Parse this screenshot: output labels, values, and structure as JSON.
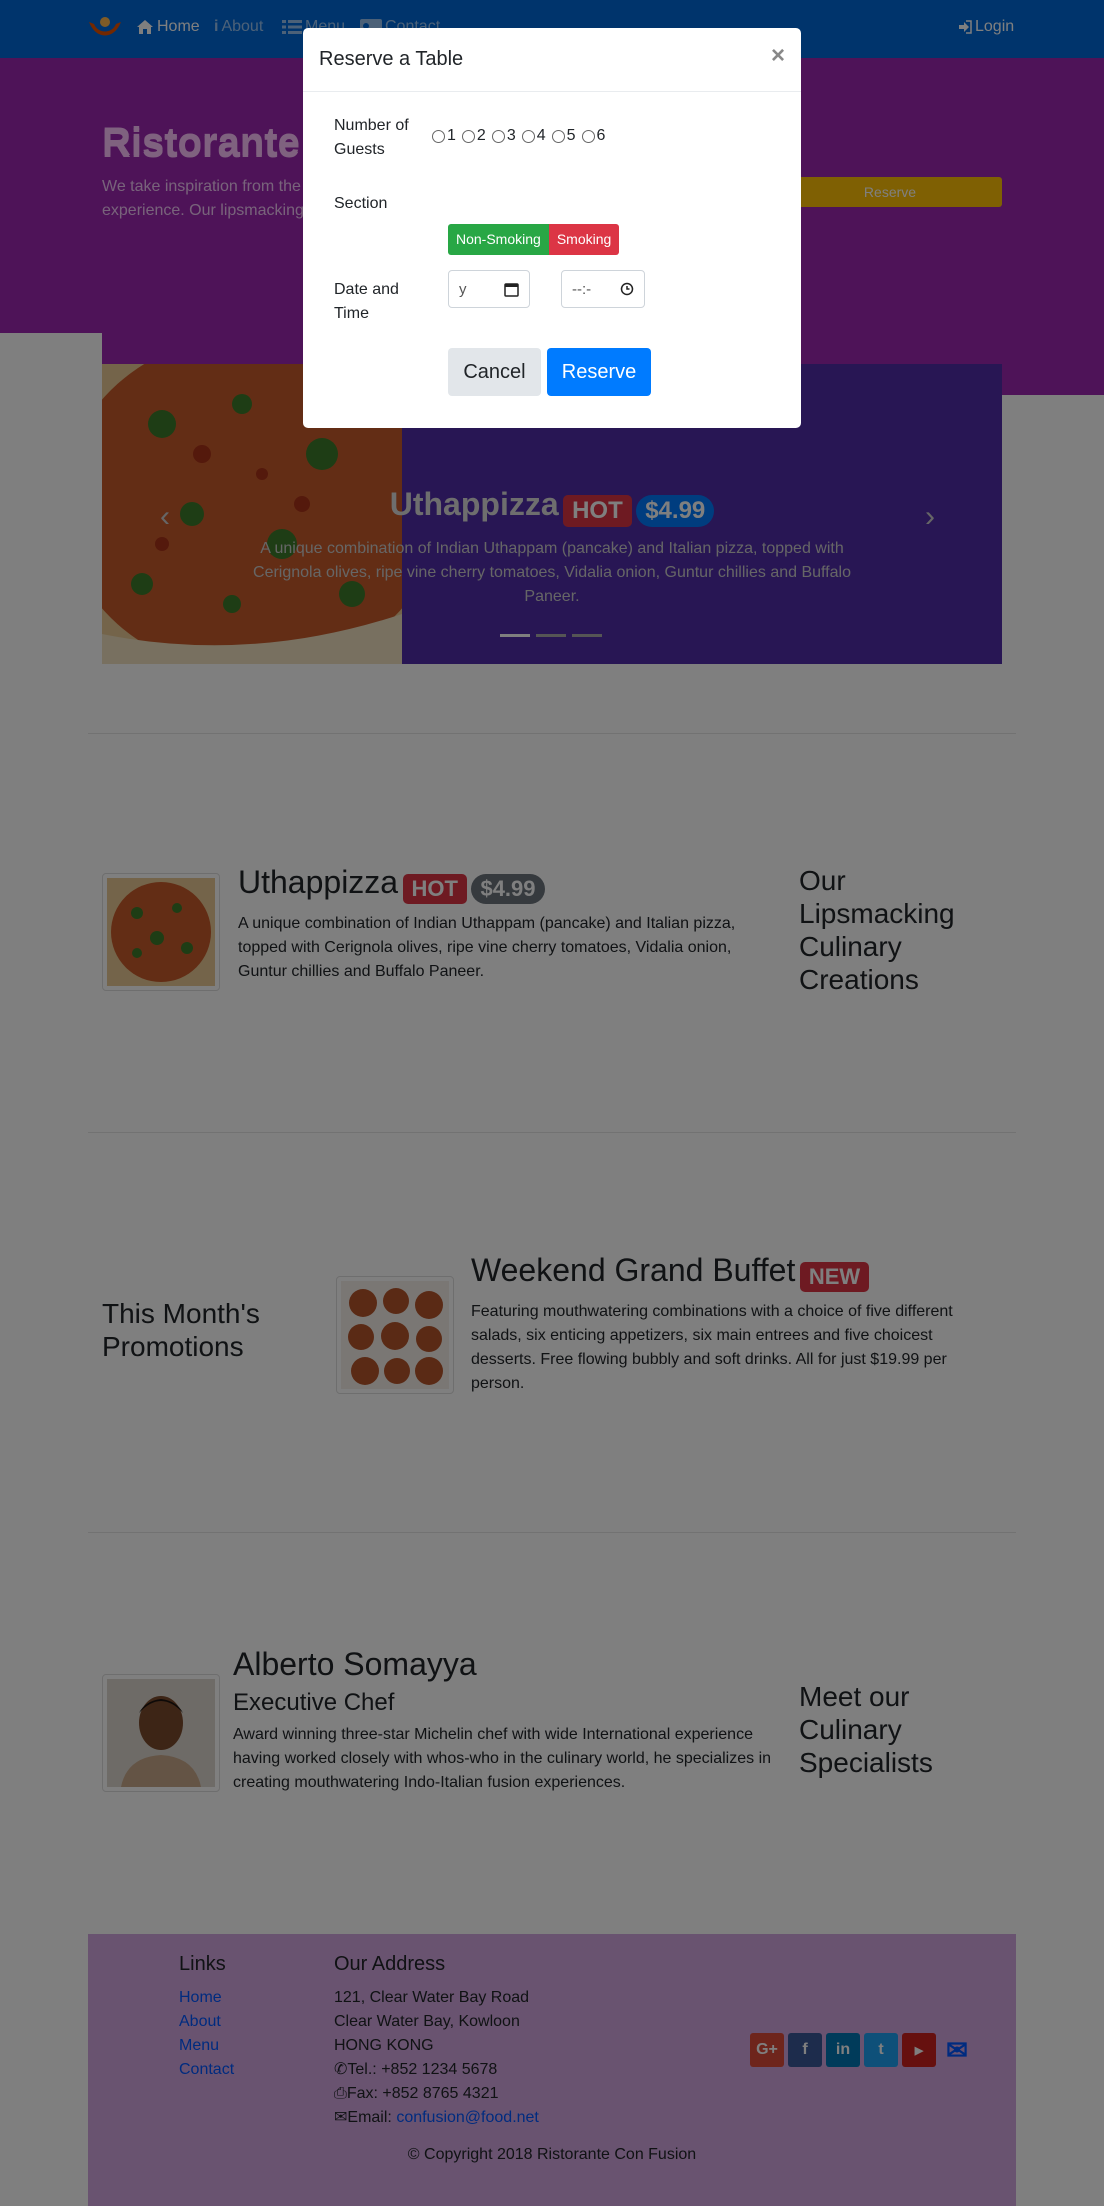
{
  "navbar": {
    "home": "Home",
    "about": "About",
    "menu": "Menu",
    "contact": "Contact",
    "login": "Login"
  },
  "jumbotron": {
    "title": "Ristorante con Fusion",
    "text": "We take inspiration from the World's best cuisines, and create a unique fusion experience. Our lipsmacking creations will tickle your culinary senses!",
    "reserve": "Reserve"
  },
  "carousel": {
    "title": "Uthappizza",
    "badge_hot": "HOT",
    "price": "$4.99",
    "description": "A unique combination of Indian Uthappam (pancake) and Italian pizza, topped with Cerignola olives, ripe vine cherry tomatoes, Vidalia onion, Guntur chillies and Buffalo Paneer."
  },
  "modal": {
    "title": "Reserve a Table",
    "close": "×",
    "guests_label": "Number of Guests",
    "guest_options": [
      "1",
      "2",
      "3",
      "4",
      "5",
      "6"
    ],
    "section_label": "Section",
    "non_smoking": "Non-Smoking",
    "smoking": "Smoking",
    "datetime_label": "Date and Time",
    "date_placeholder": "y",
    "time_placeholder": "--:-",
    "cancel": "Cancel",
    "reserve": "Reserve"
  },
  "dish": {
    "title": "Uthappizza",
    "badge_hot": "HOT",
    "price": "$4.99",
    "description": "A unique combination of Indian Uthappam (pancake) and Italian pizza, topped with Cerignola olives, ripe vine cherry tomatoes, Vidalia onion, Guntur chillies and Buffalo Paneer.",
    "side_heading": "Our Lipsmacking Culinary Creations"
  },
  "promo": {
    "side_heading": "This Month's Promotions",
    "title": "Weekend Grand Buffet",
    "badge_new": "NEW",
    "description": "Featuring mouthwatering combinations with a choice of five different salads, six enticing appetizers, six main entrees and five choicest desserts. Free flowing bubbly and soft drinks. All for just $19.99 per person."
  },
  "leader": {
    "name": "Alberto Somayya",
    "role": "Executive Chef",
    "description": "Award winning three-star Michelin chef with wide International experience having worked closely with whos-who in the culinary world, he specializes in creating mouthwatering Indo-Italian fusion experiences.",
    "side_heading": "Meet our Culinary Specialists"
  },
  "footer": {
    "links_heading": "Links",
    "links": [
      "Home",
      "About",
      "Menu",
      "Contact"
    ],
    "address_heading": "Our Address",
    "address_lines": [
      "121, Clear Water Bay Road",
      "Clear Water Bay, Kowloon",
      "HONG KONG"
    ],
    "tel": "Tel.: +852 1234 5678",
    "fax": "Fax: +852 8765 4321",
    "email_label": "Email: ",
    "email": "confusion@food.net",
    "copyright": "© Copyright 2018 Ristorante Con Fusion"
  },
  "colors": {
    "navbar": "#0069d9",
    "jumbotron": "#9c27b0",
    "carousel": "#512da8",
    "footer": "#d2a7e0",
    "hot": "#dc3545",
    "price": "#007bff",
    "success": "#28a745",
    "warning": "#ffc107"
  }
}
